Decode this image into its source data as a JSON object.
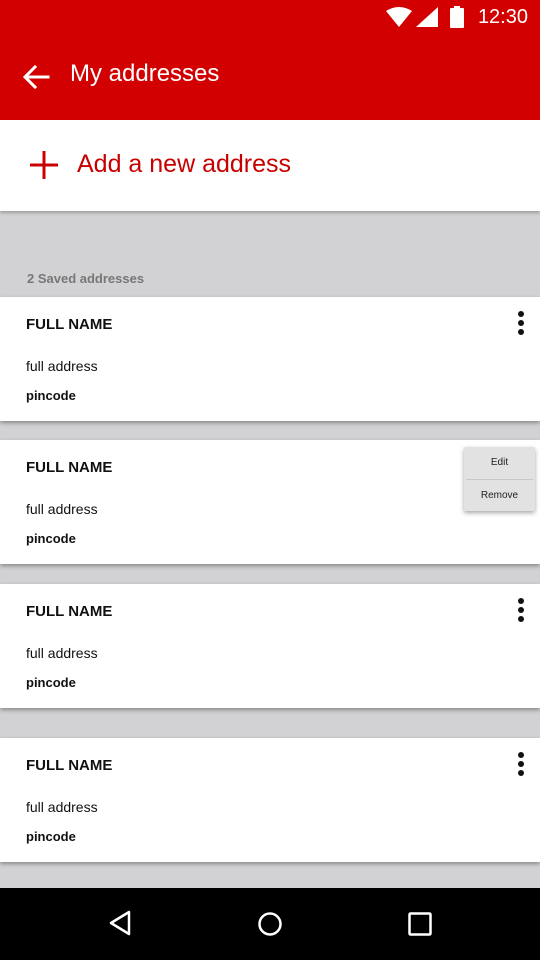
{
  "status_bar": {
    "time": "12:30"
  },
  "app_bar": {
    "title": "My addresses",
    "back_icon": "arrow-back-icon"
  },
  "add_address": {
    "label": "Add a new address",
    "icon": "plus-icon"
  },
  "saved": {
    "count_label": "2 Saved addresses"
  },
  "addresses": [
    {
      "name": "FULL NAME",
      "address": "full address",
      "pincode": "pincode"
    },
    {
      "name": "FULL NAME",
      "address": "full address",
      "pincode": "pincode"
    },
    {
      "name": "FULL NAME",
      "address": "full address",
      "pincode": "pincode"
    },
    {
      "name": "FULL NAME",
      "address": "full address",
      "pincode": "pincode"
    }
  ],
  "context_menu": {
    "edit": "Edit",
    "remove": "Remove"
  },
  "colors": {
    "accent": "#d20000",
    "background": "#d2d1d3",
    "card": "#ffffff"
  }
}
